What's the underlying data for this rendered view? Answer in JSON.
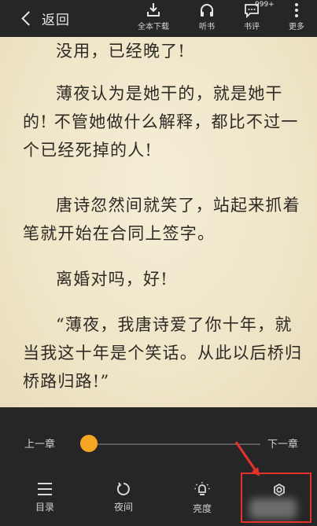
{
  "topbar": {
    "back_label": "返回",
    "buttons": [
      {
        "icon": "download-icon",
        "label": "全本下载"
      },
      {
        "icon": "headphones-icon",
        "label": "听书"
      },
      {
        "icon": "comment-icon",
        "label": "书评",
        "badge": "999+"
      },
      {
        "icon": "more-icon",
        "label": "更多"
      }
    ]
  },
  "content": {
    "paragraphs": [
      "没用，已经晚了!",
      "薄夜认为是她干的，就是她干的! 不管她做什么解释，都比不过一个已经死掉的人!",
      "唐诗忽然间就笑了，站起来抓着笔就开始在合同上签字。",
      "离婚对吗，好!",
      "“薄夜，我唐诗爱了你十年，就当我这十年是个笑话。从此以后桥归桥路归路!”"
    ]
  },
  "progress": {
    "prev_label": "上一章",
    "next_label": "下一章",
    "fraction": 0.0
  },
  "bottom_bar": {
    "items": [
      {
        "icon": "list-icon",
        "label": "目录"
      },
      {
        "icon": "night-mode-icon",
        "label": "夜间"
      },
      {
        "icon": "brightness-icon",
        "label": "亮度"
      },
      {
        "icon": "gear-icon",
        "label": ""
      }
    ]
  },
  "colors": {
    "toolbar_bg": "#262626",
    "page_bg": "#efe5c8",
    "accent": "#f6a623",
    "highlight": "#e4332b"
  }
}
